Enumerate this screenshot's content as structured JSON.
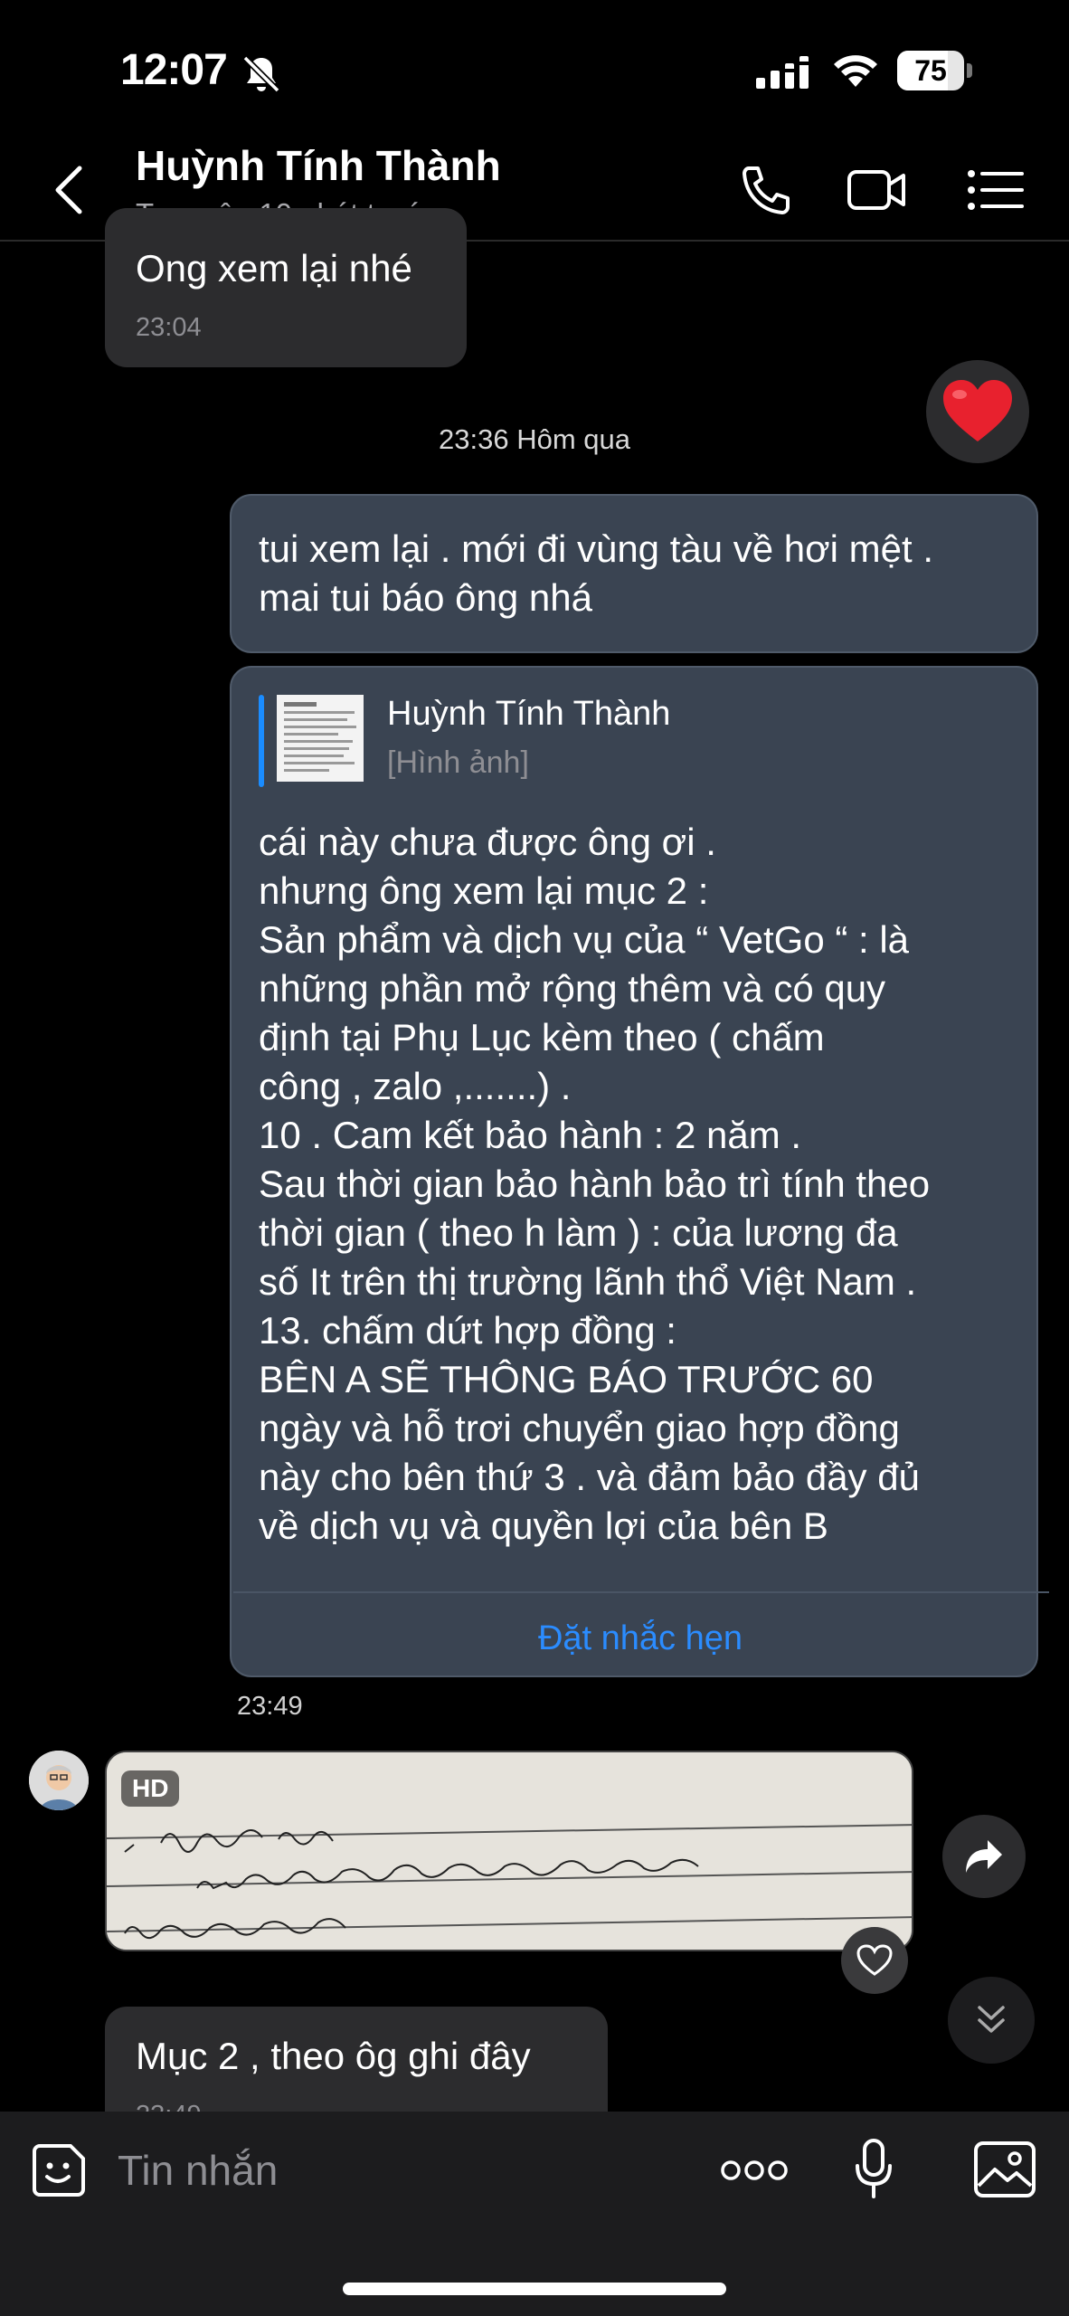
{
  "status_bar": {
    "time": "12:07",
    "battery": "75",
    "battery_level": 0.75
  },
  "header": {
    "contact_name": "Huỳnh Tính Thành",
    "status": "Truy cập 10 phút trước"
  },
  "messages": {
    "m1": {
      "text": "Ong xem lại nhé",
      "time": "23:04"
    },
    "date_separator": "23:36 Hôm qua",
    "m2": {
      "text": "tui xem lại . mới đi vùng tàu về hơi mệt .\nmai tui báo ông nhá"
    },
    "m3": {
      "reply_name": "Huỳnh Tính Thành",
      "reply_sub": "[Hình ảnh]",
      "text": "cái này chưa được ông ơi .\nnhưng ông xem lại mục 2 :\nSản phẩm và dịch vụ của “ VetGo “ : là\nnhững phần mở rộng thêm và có quy\nđịnh tại Phụ Lục kèm theo ( chấm\ncông , zalo ,.......) .\n10 . Cam kết bảo hành : 2 năm .\nSau thời gian bảo hành bảo trì tính theo\nthời gian ( theo h làm ) : của lương đa\nsố It trên thị trường lãnh thổ Việt Nam .\n13. chấm dứt hợp đồng :\nBÊN A SẼ THÔNG BÁO TRƯỚC 60\nngày và hỗ trơi chuyển giao hợp đồng\nnày cho bên thứ 3 . và đảm bảo đầy đủ\nvề dịch vụ và quyền lợi của bên B",
      "reminder": "Đặt nhắc hẹn",
      "time": "23:49"
    },
    "photo": {
      "badge": "HD"
    },
    "m4": {
      "text": "Mục 2 , theo ôg ghi đây",
      "time": "23:49"
    }
  },
  "input": {
    "placeholder": "Tin nhắn"
  },
  "icons": [
    "bell-off-icon",
    "signal-icon",
    "wifi-icon",
    "back-icon",
    "phone-icon",
    "video-icon",
    "menu-icon",
    "heart-icon",
    "share-icon",
    "like-icon",
    "scroll-down-icon",
    "sticker-icon",
    "more-icon",
    "mic-icon",
    "image-icon"
  ],
  "colors": {
    "accent": "#2b8cff",
    "outgoing_bubble": "#3a4452",
    "incoming_bubble": "#2c2c2e",
    "reaction_heart": "#e8212e"
  }
}
